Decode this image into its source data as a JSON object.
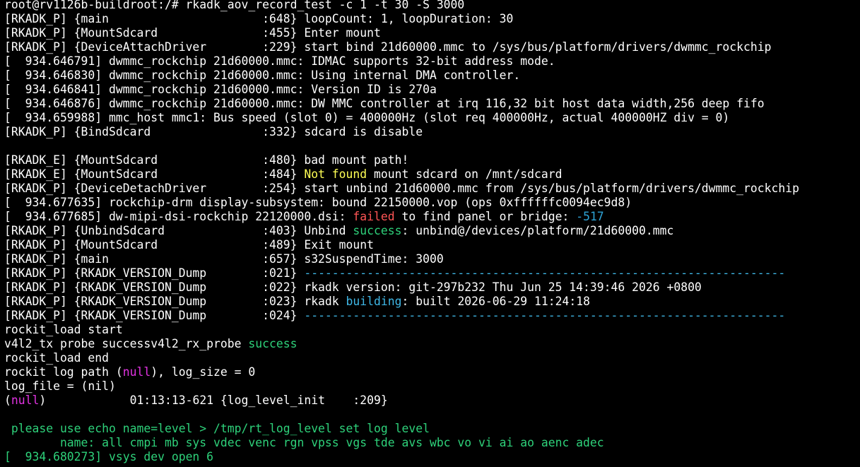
{
  "terminal": {
    "colors": {
      "background": "#000000",
      "text": "#ffffff",
      "yellow": "#ffff55",
      "red": "#ff5555",
      "blue": "#2ea3d6",
      "cyan": "#3fb7e6",
      "green": "#2ed17a",
      "magenta": "#e233e2"
    },
    "lines": [
      [
        {
          "t": "root@rv1126b-buildroot:/# rkadk_aov_record_test -c 1 -t 30 -S 3000",
          "c": "white"
        }
      ],
      [
        {
          "t": "[RKADK_P] {main                      :648} loopCount: 1, loopDuration: 30",
          "c": "white"
        }
      ],
      [
        {
          "t": "[RKADK_P] {MountSdcard               :455} Enter mount",
          "c": "white"
        }
      ],
      [
        {
          "t": "[RKADK_P] {DeviceAttachDriver        :229} start bind 21d60000.mmc to /sys/bus/platform/drivers/dwmmc_rockchip",
          "c": "white"
        }
      ],
      [
        {
          "t": "[  934.646791] dwmmc_rockchip 21d60000.mmc: IDMAC supports 32-bit address mode.",
          "c": "white"
        }
      ],
      [
        {
          "t": "[  934.646830] dwmmc_rockchip 21d60000.mmc: Using internal DMA controller.",
          "c": "white"
        }
      ],
      [
        {
          "t": "[  934.646841] dwmmc_rockchip 21d60000.mmc: Version ID is 270a",
          "c": "white"
        }
      ],
      [
        {
          "t": "[  934.646876] dwmmc_rockchip 21d60000.mmc: DW MMC controller at irq 116,32 bit host data width,256 deep fifo",
          "c": "white"
        }
      ],
      [
        {
          "t": "[  934.659988] mmc_host mmc1: Bus speed (slot 0) = 400000Hz (slot req 400000Hz, actual 400000HZ div = 0)",
          "c": "white"
        }
      ],
      [
        {
          "t": "[RKADK_P] {BindSdcard                :332} sdcard is disable",
          "c": "white"
        }
      ],
      [
        {
          "t": "",
          "c": "white"
        }
      ],
      [
        {
          "t": "[RKADK_E] {MountSdcard               :480} bad mount path!",
          "c": "white"
        }
      ],
      [
        {
          "t": "[RKADK_E] {MountSdcard               :484} ",
          "c": "white"
        },
        {
          "t": "Not found",
          "c": "yellow"
        },
        {
          "t": " mount sdcard on /mnt/sdcard",
          "c": "white"
        }
      ],
      [
        {
          "t": "[RKADK_P] {DeviceDetachDriver        :254} start unbind 21d60000.mmc from /sys/bus/platform/drivers/dwmmc_rockchip",
          "c": "white"
        }
      ],
      [
        {
          "t": "[  934.677635] rockchip-drm display-subsystem: bound 22150000.vop (ops 0xffffffc0094ec9d8)",
          "c": "white"
        }
      ],
      [
        {
          "t": "[  934.677685] dw-mipi-dsi-rockchip 22120000.dsi: ",
          "c": "white"
        },
        {
          "t": "failed",
          "c": "red"
        },
        {
          "t": " to find panel or bridge: ",
          "c": "white"
        },
        {
          "t": "-517",
          "c": "blue"
        }
      ],
      [
        {
          "t": "[RKADK_P] {UnbindSdcard              :403} Unbind ",
          "c": "white"
        },
        {
          "t": "success",
          "c": "green"
        },
        {
          "t": ": unbind@/devices/platform/21d60000.mmc",
          "c": "white"
        }
      ],
      [
        {
          "t": "[RKADK_P] {MountSdcard               :489} Exit mount",
          "c": "white"
        }
      ],
      [
        {
          "t": "[RKADK_P] {main                      :657} s32SuspendTime: 3000",
          "c": "white"
        }
      ],
      [
        {
          "t": "[RKADK_P] {RKADK_VERSION_Dump        :021} ",
          "c": "white"
        },
        {
          "t": "---------------------------------------------------------------------",
          "c": "cyan"
        }
      ],
      [
        {
          "t": "[RKADK_P] {RKADK_VERSION_Dump        :022} rkadk version: git-297b232 Thu Jun 25 14:39:46 2026 +0800",
          "c": "white"
        }
      ],
      [
        {
          "t": "[RKADK_P] {RKADK_VERSION_Dump        :023} rkadk ",
          "c": "white"
        },
        {
          "t": "building",
          "c": "cyan"
        },
        {
          "t": ": built 2026-06-29 11:24:18",
          "c": "white"
        }
      ],
      [
        {
          "t": "[RKADK_P] {RKADK_VERSION_Dump        :024} ",
          "c": "white"
        },
        {
          "t": "---------------------------------------------------------------------",
          "c": "cyan"
        }
      ],
      [
        {
          "t": "rockit_load start",
          "c": "white"
        }
      ],
      [
        {
          "t": "v4l2_tx probe successv4l2_rx_probe ",
          "c": "white"
        },
        {
          "t": "success",
          "c": "green"
        }
      ],
      [
        {
          "t": "rockit_load end",
          "c": "white"
        }
      ],
      [
        {
          "t": "rockit log path (",
          "c": "white"
        },
        {
          "t": "null",
          "c": "magenta"
        },
        {
          "t": "), log_size = 0",
          "c": "white"
        }
      ],
      [
        {
          "t": "log_file = (nil)",
          "c": "white"
        }
      ],
      [
        {
          "t": "(",
          "c": "white"
        },
        {
          "t": "null",
          "c": "magenta"
        },
        {
          "t": ")            01:13:13-621 {log_level_init    :209}",
          "c": "white"
        }
      ],
      [
        {
          "t": "",
          "c": "white"
        }
      ],
      [
        {
          "t": " please use echo name=level > /tmp/rt_log_level set log level",
          "c": "green"
        }
      ],
      [
        {
          "t": "        name: all cmpi mb sys vdec venc rgn vpss vgs tde avs wbc vo vi ai ao aenc adec",
          "c": "green"
        }
      ],
      [
        {
          "t": "[  934.680273] vsys dev open 6",
          "c": "green"
        }
      ]
    ]
  }
}
